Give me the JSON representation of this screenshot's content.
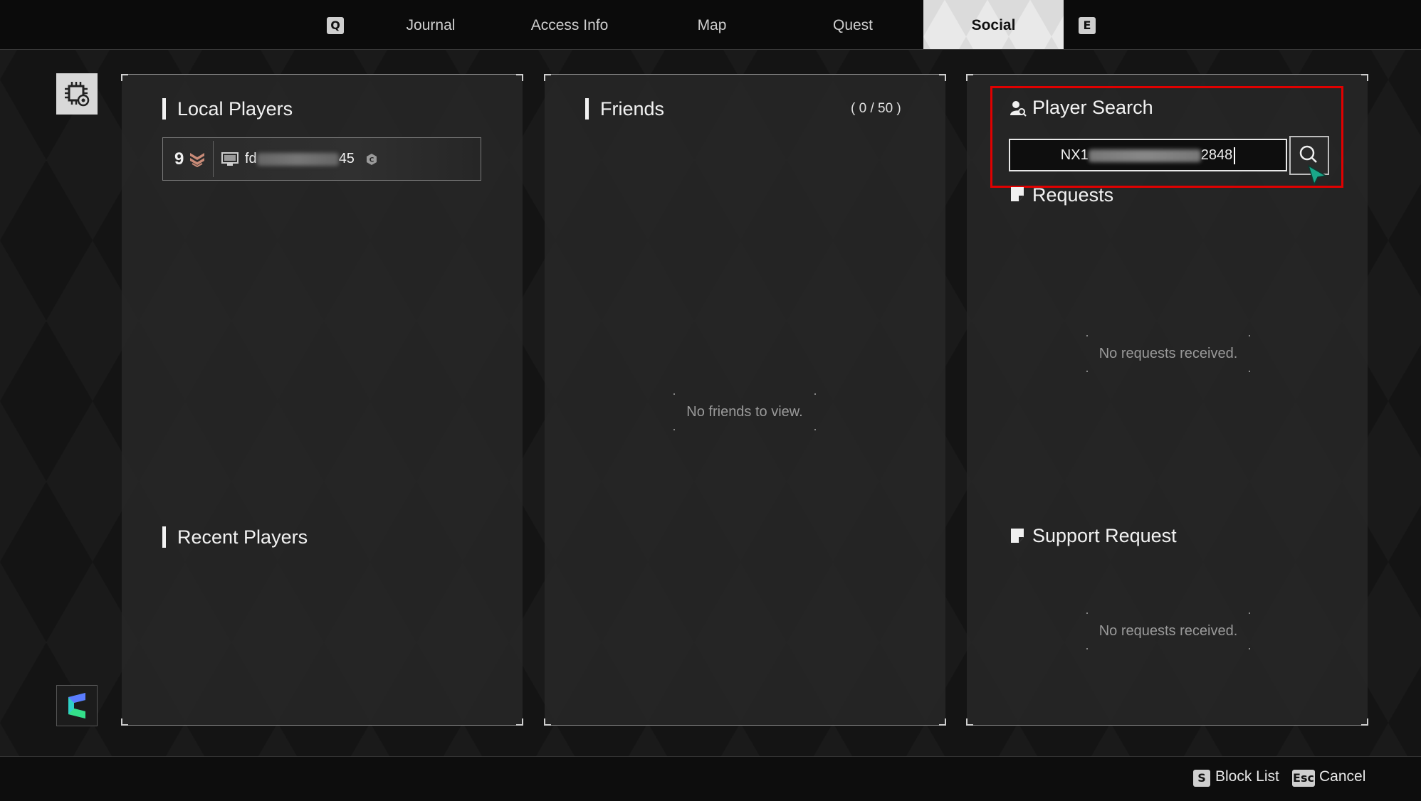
{
  "nav": {
    "prev_key": "Q",
    "next_key": "E",
    "tabs": [
      {
        "label": "Journal",
        "active": false
      },
      {
        "label": "Access Info",
        "active": false
      },
      {
        "label": "Map",
        "active": false
      },
      {
        "label": "Quest",
        "active": false
      },
      {
        "label": "Social",
        "active": true
      }
    ]
  },
  "sidebar": {
    "top_icon": "settings-chip-icon",
    "bottom_icon": "brand-logo-icon"
  },
  "local_players": {
    "title": "Local Players",
    "players": [
      {
        "level": "9",
        "rank_icon": "rank-chevron-icon",
        "platform_icon": "pc-monitor-icon",
        "name_prefix": "fd",
        "name_suffix": "45",
        "badge_icon": "cross-platform-icon"
      }
    ]
  },
  "recent_players": {
    "title": "Recent Players"
  },
  "friends": {
    "title": "Friends",
    "count": "( 0 / 50 )",
    "empty_text": "No friends to view."
  },
  "player_search": {
    "title": "Player Search",
    "input_prefix": "NX1",
    "input_suffix": "2848",
    "search_icon": "search-icon"
  },
  "requests": {
    "title": "Requests",
    "empty_text": "No requests received."
  },
  "support_request": {
    "title": "Support Request",
    "empty_text": "No requests received."
  },
  "footer": {
    "block_key": "S",
    "block_label": "Block List",
    "cancel_key": "Esc",
    "cancel_label": "Cancel"
  },
  "colors": {
    "highlight": "#e00000",
    "accent_cursor": "#1aa88a",
    "rank": "#c98b78"
  }
}
